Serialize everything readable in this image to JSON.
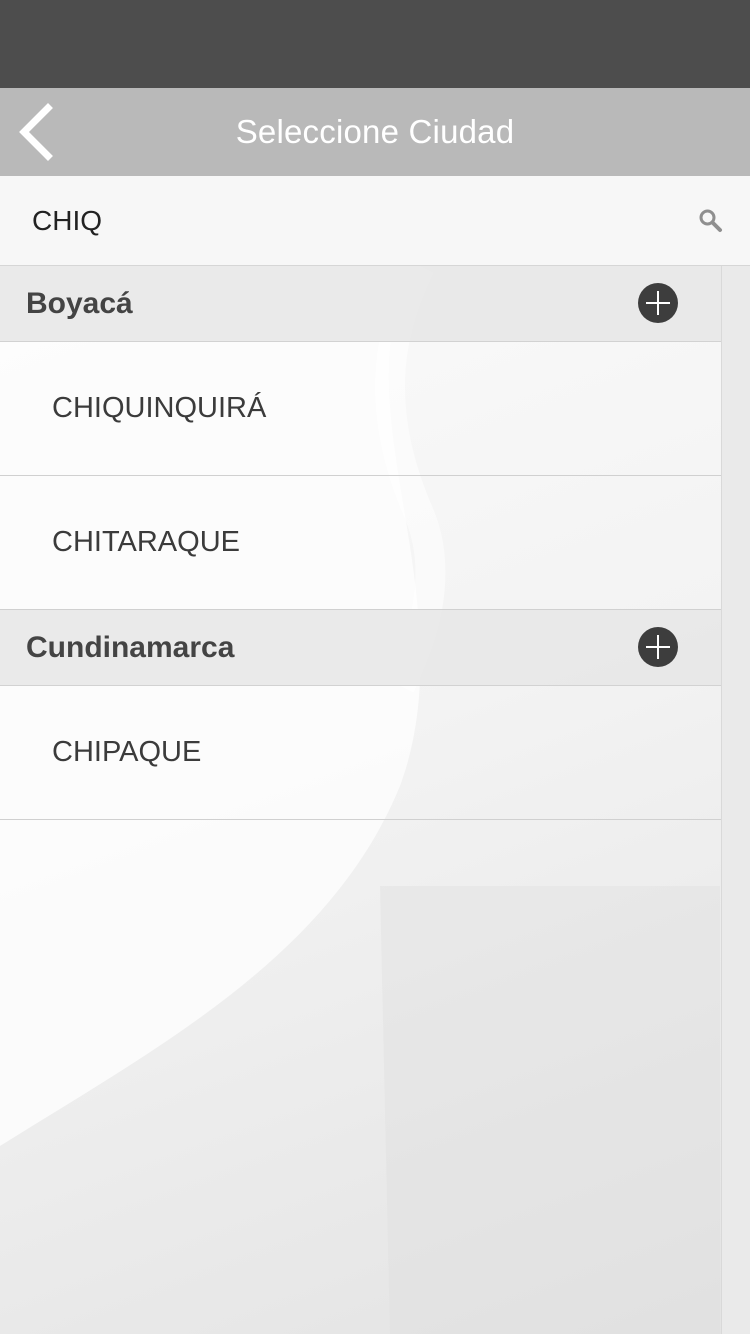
{
  "header": {
    "title": "Seleccione Ciudad",
    "back_icon": "chevron-left-icon"
  },
  "search": {
    "value": "CHIQ",
    "icon": "search-icon"
  },
  "sections": [
    {
      "title": "Boyacá",
      "action_icon": "plus-circle-icon",
      "items": [
        "CHIQUINQUIRÁ",
        "CHITARAQUE"
      ]
    },
    {
      "title": "Cundinamarca",
      "action_icon": "plus-circle-icon",
      "items": [
        "CHIPAQUE"
      ]
    }
  ],
  "colors": {
    "status_bar": "#4d4d4d",
    "nav_bar": "#b9b9b9",
    "add_button": "#3d3d3d"
  }
}
